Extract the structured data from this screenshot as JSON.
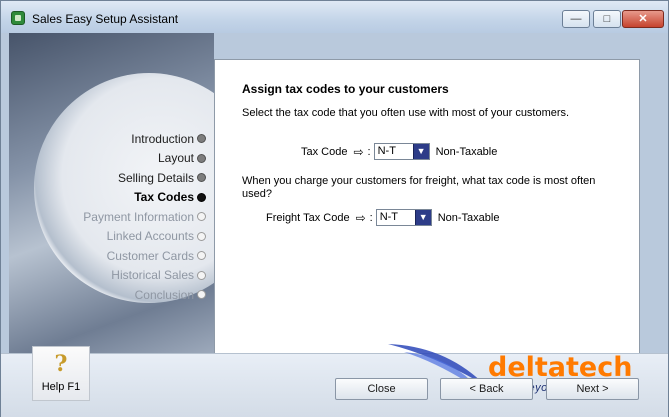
{
  "window": {
    "title": "Sales Easy Setup Assistant",
    "min_icon": "minimize-icon",
    "max_icon": "maximize-icon",
    "close_icon": "close-icon"
  },
  "steps": [
    {
      "label": "Introduction",
      "state": "done"
    },
    {
      "label": "Layout",
      "state": "done"
    },
    {
      "label": "Selling Details",
      "state": "done"
    },
    {
      "label": "Tax Codes",
      "state": "current"
    },
    {
      "label": "Payment Information",
      "state": "future"
    },
    {
      "label": "Linked Accounts",
      "state": "future"
    },
    {
      "label": "Customer Cards",
      "state": "future"
    },
    {
      "label": "Historical Sales",
      "state": "future"
    },
    {
      "label": "Conclusion",
      "state": "future"
    }
  ],
  "main": {
    "heading": "Assign tax codes to your customers",
    "para1": "Select the tax code that you often use with most of your customers.",
    "tax_code_label": "Tax Code",
    "tax_code_value": "N-T",
    "tax_code_desc": "Non-Taxable",
    "para2": "When you charge your customers for freight, what tax code is most often used?",
    "freight_label": "Freight Tax Code",
    "freight_value": "N-T",
    "freight_desc": "Non-Taxable"
  },
  "footer": {
    "help_label": "Help F1",
    "close_label": "Close",
    "back_label": "< Back",
    "next_label": "Next >"
  },
  "logo": {
    "name": "deltatech",
    "tagline": "taking beyond ordinary!",
    "color": "#ff7a00"
  }
}
